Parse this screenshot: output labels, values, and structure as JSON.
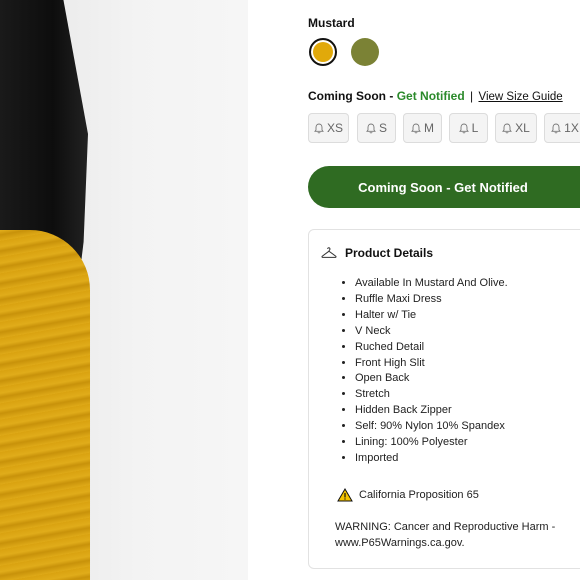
{
  "product": {
    "selected_color": "Mustard",
    "swatches": [
      {
        "name": "Mustard",
        "hex": "#e1a90a",
        "selected": true
      },
      {
        "name": "Olive",
        "hex": "#7b8235",
        "selected": false
      }
    ]
  },
  "availability": {
    "status": "Coming Soon",
    "separator": "-",
    "notify_link": "Get Notified",
    "divider": "|",
    "size_guide_link": "View Size Guide"
  },
  "sizes": [
    "XS",
    "S",
    "M",
    "L",
    "XL",
    "1X"
  ],
  "cta": {
    "label": "Coming Soon - Get Notified"
  },
  "details": {
    "title": "Product Details",
    "features": [
      "Available In Mustard And Olive.",
      "Ruffle Maxi Dress",
      "Halter w/ Tie",
      "V Neck",
      "Ruched Detail",
      "Front High Slit",
      "Open Back",
      "Stretch",
      "Hidden Back Zipper",
      "Self: 90% Nylon 10% Spandex",
      "Lining: 100% Polyester",
      "Imported"
    ],
    "prop65_title": "California Proposition 65",
    "warning_text": "WARNING: Cancer and Reproductive Harm - www.P65Warnings.ca.gov."
  },
  "colors": {
    "accent_green": "#2b8a2b",
    "cta_green": "#2f6b22",
    "warning_yellow": "#f5c400"
  },
  "icons": {
    "bell": "bell-icon",
    "hanger": "hanger-icon",
    "warning": "warning-triangle-icon"
  }
}
